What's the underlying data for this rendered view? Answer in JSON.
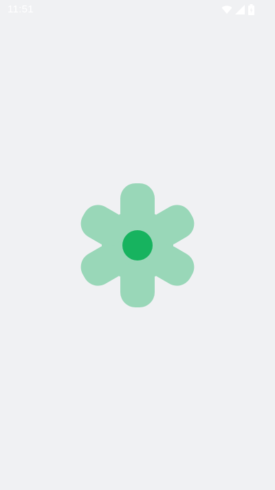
{
  "status_bar": {
    "time": "11:51",
    "icons": [
      "wifi-icon",
      "cellular-signal-icon",
      "battery-icon"
    ]
  },
  "splash": {
    "logo_icon": "gear-icon",
    "colors": {
      "background": "#f0f1f3",
      "gear_fill": "#99d7b8",
      "gear_center": "#17b35f",
      "status_icons": "#ffffff"
    }
  }
}
